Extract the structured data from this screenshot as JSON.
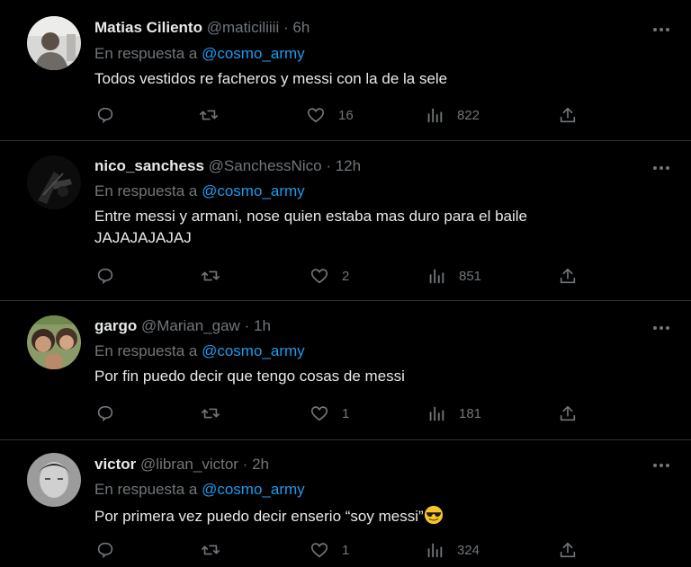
{
  "colors": {
    "background": "#000000",
    "text": "#e7e9ea",
    "muted": "#71767b",
    "link": "#1d9bf0",
    "divider": "#2f3336"
  },
  "reply_prefix": "En respuesta a",
  "tweets": [
    {
      "name": "Matias Ciliento",
      "handle": "@maticiliiii",
      "separator": "·",
      "time": "6h",
      "reply_to": "@cosmo_army",
      "text": "Todos vestidos re facheros y messi con la de la sele",
      "likes": "16",
      "views": "822",
      "icons": [
        "reply-icon",
        "retweet-icon",
        "like-icon",
        "views-icon",
        "share-icon",
        "more-icon"
      ]
    },
    {
      "name": "nico_sanchess",
      "handle": "@SanchessNico",
      "separator": "·",
      "time": "12h",
      "reply_to": "@cosmo_army",
      "text_line1": "Entre messi y armani, nose quien estaba mas duro para el baile",
      "text_line2": "JAJAJAJAJAJ",
      "likes": "2",
      "views": "851"
    },
    {
      "name": "gargo",
      "handle": "@Marian_gaw",
      "separator": "·",
      "time": "1h",
      "reply_to": "@cosmo_army",
      "text": "Por fin puedo decir que tengo cosas de messi",
      "likes": "1",
      "views": "181"
    },
    {
      "name": "victor",
      "handle": "@libran_victor",
      "separator": "·",
      "time": "2h",
      "reply_to": "@cosmo_army",
      "text": "Por primera vez puedo decir enserio “soy messi”",
      "emoji": "sunglasses-emoji",
      "likes": "1",
      "views": "324"
    }
  ]
}
